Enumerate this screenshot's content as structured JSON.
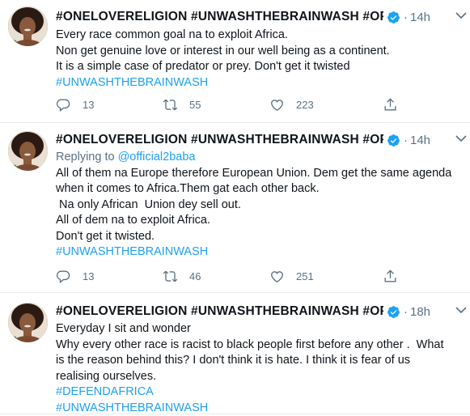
{
  "tweets": [
    {
      "name": "#ONELOVERELIGION #UNWASHTHEBRAINWASH #OPE...",
      "time": "14h",
      "dot": "·",
      "reply_prefix": "",
      "reply_handle": "",
      "lines": [
        "Every race common goal na to exploit Africa.",
        "Non get genuine love or interest in our well being as a continent.",
        "It is a simple case of predator or prey. Don't  get it twisted"
      ],
      "hashtags": [
        "#UNWASHTHEBRAINWASH"
      ],
      "replies": "13",
      "retweets": "55",
      "likes": "223"
    },
    {
      "name": "#ONELOVERELIGION #UNWASHTHEBRAINWASH #OPE...",
      "time": "14h",
      "dot": "·",
      "reply_prefix": "Replying to ",
      "reply_handle": "@official2baba",
      "lines": [
        "All of them na Europe therefore European Union. Dem get the same agenda",
        "when it comes to Africa.Them gat each other back.",
        " Na only African  Union dey sell out.",
        "All of dem na to exploit Africa.",
        "Don't get it twisted."
      ],
      "hashtags": [
        "#UNWASHTHEBRAINWASH"
      ],
      "replies": "13",
      "retweets": "46",
      "likes": "251"
    },
    {
      "name": "#ONELOVERELIGION #UNWASHTHEBRAINWASH #OPE...",
      "time": "18h",
      "dot": "·",
      "reply_prefix": "",
      "reply_handle": "",
      "lines": [
        "Everyday I sit and wonder",
        "Why every other race is racist to black people first before any other .  What",
        "is the reason behind this? I don't think it is hate. I think it is fear of us",
        "realising ourselves."
      ],
      "hashtags": [
        "#DEFENDAFRICA",
        "#UNWASHTHEBRAINWASH"
      ]
    }
  ],
  "icons": {
    "reply": "reply-icon",
    "retweet": "retweet-icon",
    "like": "heart-icon",
    "share": "share-icon",
    "verified": "verified-badge-icon",
    "more": "chevron-down-icon"
  },
  "colors": {
    "link": "#1da1f2",
    "muted": "#5b7083",
    "divider": "#e6ecf0",
    "verified": "#1da1f2"
  }
}
